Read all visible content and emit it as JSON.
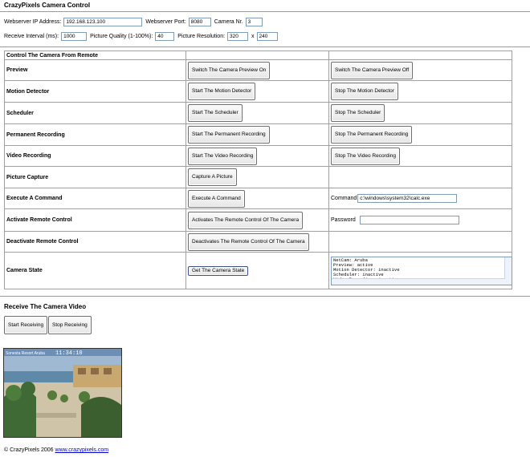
{
  "app": {
    "title": "CrazyPixels Camera Control"
  },
  "settings": {
    "ip_label": "Webserver IP Address:",
    "ip_value": "192.168.123.100",
    "port_label": "Webserver Port:",
    "port_value": "8080",
    "camera_label": "Camera Nr.",
    "camera_value": "3",
    "interval_label": "Receive Interval (ms):",
    "interval_value": "1000",
    "quality_label": "Picture Quality (1-100%):",
    "quality_value": "40",
    "resolution_label": "Picture Resolution:",
    "res_w": "320",
    "res_x": "x",
    "res_h": "240"
  },
  "control": {
    "header": "Control The Camera From Remote",
    "preview": {
      "label": "Preview",
      "on": "Switch The Camera Preview On",
      "off": "Switch The Camera Preview Off"
    },
    "motion": {
      "label": "Motion Detector",
      "start": "Start The Motion Detector",
      "stop": "Stop The Motion Detector"
    },
    "scheduler": {
      "label": "Scheduler",
      "start": "Start The Scheduler",
      "stop": "Stop The Scheduler"
    },
    "permanent": {
      "label": "Permanent Recording",
      "start": "Start The Permanent Recording",
      "stop": "Stop The Permanent Recording"
    },
    "video": {
      "label": "Video Recording",
      "start": "Start The Video Recording",
      "stop": "Stop The Video Recording"
    },
    "capture": {
      "label": "Picture Capture",
      "button": "Capture A Picture"
    },
    "execute": {
      "label": "Execute A Command",
      "button": "Execute A Command",
      "command_label": "Command",
      "command_value": "c:\\windows\\system32\\calc.exe"
    },
    "activate": {
      "label": "Activate Remote Control",
      "button": "Activates The Remote Control Of The Camera",
      "password_label": "Password",
      "password_value": ""
    },
    "deactivate": {
      "label": "Deactivate Remote Control",
      "button": "Deactivates The Remote Control Of The Camera"
    },
    "state": {
      "label": "Camera State",
      "button": "Get The Camera State",
      "lines": [
        "NetCam: Aruba",
        "Preview: active",
        "Motion Detector: inactive",
        "Scheduler: inactive",
        "Video Recording: inactive"
      ]
    }
  },
  "receive": {
    "header": "Receive The Camera Video",
    "start": "Start Receiving",
    "stop": "Stop Receiving",
    "overlay_text": "Sonesta Resort Aruba",
    "overlay_time": "11:34:10"
  },
  "footer": {
    "copyright": "© CrazyPixels 2006",
    "link": "www.crazypixels.com"
  },
  "colors": {
    "input_border": "#7f9db9",
    "link": "#0000cc",
    "table_border": "#a0a0a0"
  }
}
